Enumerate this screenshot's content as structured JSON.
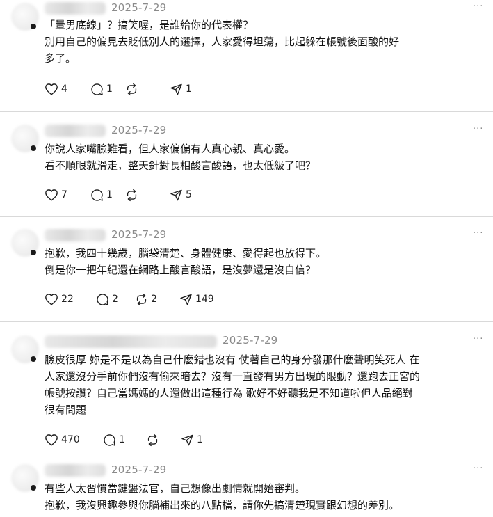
{
  "posts": [
    {
      "date": "2025-7-29",
      "more": "···",
      "lines": [
        "「暈男底線」？搞笑喔，是誰給你的代表權？",
        "別用自己的偏見去貶低別人的選擇，人家愛得坦蕩，比起躲在帳號後面酸的好",
        "多了。"
      ],
      "likes": "4",
      "replies": "1",
      "reposts": "",
      "shares": "1"
    },
    {
      "date": "2025-7-29",
      "more": "···",
      "lines": [
        "你說人家嘴臉難看，但人家偏偏有人真心親、真心愛。",
        "看不順眼就滑走，整天針對長相酸言酸語，也太低級了吧？"
      ],
      "likes": "7",
      "replies": "1",
      "reposts": "",
      "shares": "5"
    },
    {
      "date": "2025-7-29",
      "more": "···",
      "lines": [
        "抱歉，我四十幾歲，腦袋清楚、身體健康、愛得起也放得下。",
        "倒是你一把年紀還在網路上酸言酸語，是沒夢還是沒自信？"
      ],
      "likes": "22",
      "replies": "2",
      "reposts": "2",
      "shares": "149"
    },
    {
      "date": "2025-7-29",
      "more": "···",
      "lines": [
        "臉皮很厚 妳是不是以為自己什麼錯也沒有 仗著自己的身分發那什麼聲明笑死人 在",
        "人家還沒分手前你們沒有偷來暗去？沒有一直發有男方出現的限動？還跑去正宮的",
        "帳號按讚？自己當媽媽的人還做出這種行為 歌好不好聽我是不知道啦但人品絕對",
        "很有問題"
      ],
      "likes": "470",
      "replies": "1",
      "reposts": "",
      "shares": "1"
    },
    {
      "date": "2025-7-29",
      "more": "···",
      "lines": [
        "有些人太習慣當鍵盤法官，自己想像出劇情就開始審判。",
        "抱歉，我沒興趣參與你腦補出來的八點檔，請你先搞清楚現實跟幻想的差別。"
      ]
    }
  ]
}
